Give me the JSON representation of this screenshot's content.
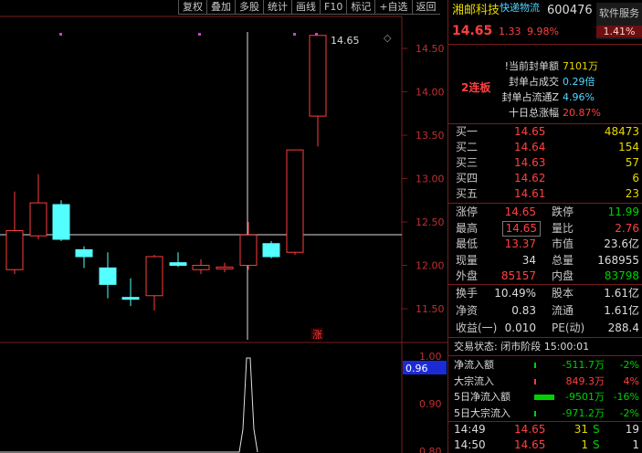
{
  "toolbar": [
    "复权",
    "叠加",
    "多股",
    "统计",
    "画线",
    "F10",
    "标记",
    "+自选",
    "返回"
  ],
  "stock": {
    "name": "湘邮科技",
    "tag": "快递物流",
    "code": "600476",
    "price": "14.65",
    "change": "1.33",
    "change_pct": "9.98%",
    "sector_label": "软件服务",
    "sector_pct": "1.41%",
    "streak": "2连板"
  },
  "seal_info": [
    {
      "label": "!当前封单额",
      "value": "7101万",
      "color": "y"
    },
    {
      "label": "封单占成交",
      "value": "0.29倍",
      "color": "c"
    },
    {
      "label": "封单占流通Z",
      "value": "4.96%",
      "color": "c"
    },
    {
      "label": "十日总涨幅",
      "value": "20.87%",
      "color": "r"
    }
  ],
  "order_book": [
    {
      "label": "买一",
      "price": "14.65",
      "vol": "48473"
    },
    {
      "label": "买二",
      "price": "14.64",
      "vol": "154"
    },
    {
      "label": "买三",
      "price": "14.63",
      "vol": "57"
    },
    {
      "label": "买四",
      "price": "14.62",
      "vol": "6"
    },
    {
      "label": "买五",
      "price": "14.61",
      "vol": "23"
    }
  ],
  "stats": [
    {
      "l1": "涨停",
      "v1": "14.65",
      "c1": "r",
      "l2": "跌停",
      "v2": "11.99",
      "c2": "g"
    },
    {
      "l1": "最高",
      "v1": "14.65",
      "c1": "r",
      "l2": "量比",
      "v2": "2.76",
      "c2": "r"
    },
    {
      "l1": "最低",
      "v1": "13.37",
      "c1": "r",
      "l2": "市值",
      "v2": "23.6亿",
      "c2": "w"
    },
    {
      "l1": "现量",
      "v1": "34",
      "c1": "w",
      "l2": "总量",
      "v2": "168955",
      "c2": "w"
    },
    {
      "l1": "外盘",
      "v1": "85157",
      "c1": "r",
      "l2": "内盘",
      "v2": "83798",
      "c2": "g"
    }
  ],
  "stats2": [
    {
      "l1": "换手",
      "v1": "10.49%",
      "l2": "股本",
      "v2": "1.61亿"
    },
    {
      "l1": "净资",
      "v1": "0.83",
      "l2": "流通",
      "v2": "1.61亿"
    },
    {
      "l1": "收益(一)",
      "v1": "0.010",
      "l2": "PE(动)",
      "v2": "288.4"
    }
  ],
  "trade_status": "交易状态: 闭市阶段 15:00:01",
  "flows": [
    {
      "label": "净流入额",
      "value": "-511.7万",
      "pct": "-2%",
      "c": "g"
    },
    {
      "label": "大宗流入",
      "value": "849.3万",
      "pct": "4%",
      "c": "r"
    },
    {
      "label": "5日净流入额",
      "value": "-9501万",
      "pct": "-16%",
      "c": "g"
    },
    {
      "label": "5日大宗流入",
      "value": "-971.2万",
      "pct": "-2%",
      "c": "g"
    }
  ],
  "ticks": [
    {
      "time": "14:49",
      "price": "14.65",
      "vol": "31",
      "flag": "S",
      "n": "19"
    },
    {
      "time": "14:50",
      "price": "14.65",
      "vol": "1",
      "flag": "S",
      "n": "1"
    }
  ],
  "chart": {
    "high_label": "14.65",
    "limit_marker": "涨",
    "price_axis": [
      "14.50",
      "14.00",
      "13.50",
      "13.00",
      "12.50",
      "12.00",
      "11.50"
    ],
    "osc_axis": [
      "1.00",
      "0.96",
      "0.90",
      "0.80"
    ],
    "osc_value": "0.96"
  },
  "colors": {
    "up": "#ff3c3c",
    "down": "#54ffff",
    "grid": "#7a1b1b"
  }
}
